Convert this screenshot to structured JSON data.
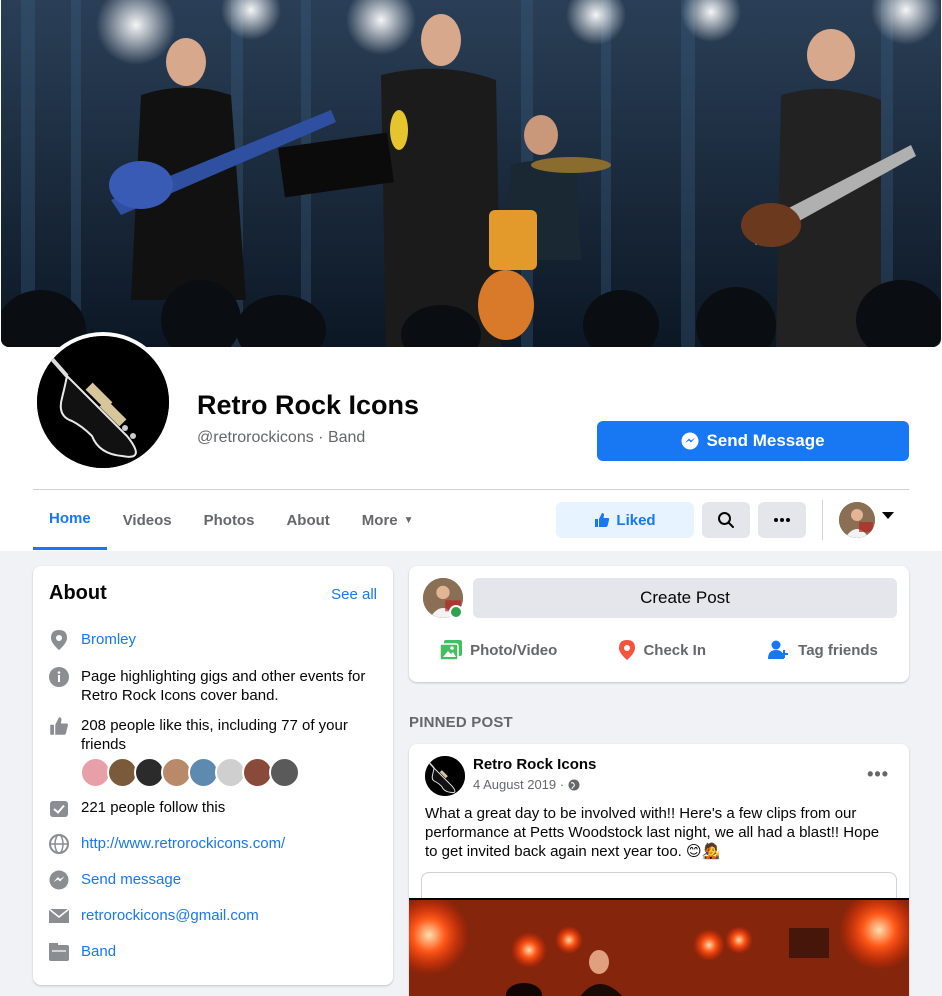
{
  "page": {
    "name": "Retro Rock Icons",
    "handle_category": "@retrorockicons · Band",
    "send_message_label": "Send Message"
  },
  "tabs": [
    {
      "label": "Home",
      "active": true
    },
    {
      "label": "Videos"
    },
    {
      "label": "Photos"
    },
    {
      "label": "About"
    },
    {
      "label": "More"
    }
  ],
  "actions": {
    "liked_label": "Liked",
    "search_icon": "search-icon",
    "more_icon": "ellipsis-icon"
  },
  "about": {
    "title": "About",
    "see_all": "See all",
    "location": "Bromley",
    "description": "Page highlighting gigs and other events for Retro Rock Icons cover band.",
    "likes": "208 people like this, including 77 of your friends",
    "followers": "221 people follow this",
    "website": "http://www.retrorockicons.com/",
    "send_message": "Send message",
    "email": "retrorockicons@gmail.com",
    "category": "Band"
  },
  "create_post": {
    "label": "Create Post",
    "photo_video": "Photo/Video",
    "check_in": "Check In",
    "tag_friends": "Tag friends"
  },
  "pinned": {
    "section_label": "PINNED POST",
    "author": "Retro Rock Icons",
    "date": "4 August 2019 ·",
    "text": "What a great day to be involved with!! Here's a few clips from our performance at Petts Woodstock last night, we all had a blast!! Hope to get invited back again next year too. 😊🧑‍🎤"
  },
  "colors": {
    "brand_blue": "#1877f2",
    "liked_bg": "#e7f3ff",
    "page_bg": "#f0f2f5",
    "online_green": "#31a24c"
  }
}
